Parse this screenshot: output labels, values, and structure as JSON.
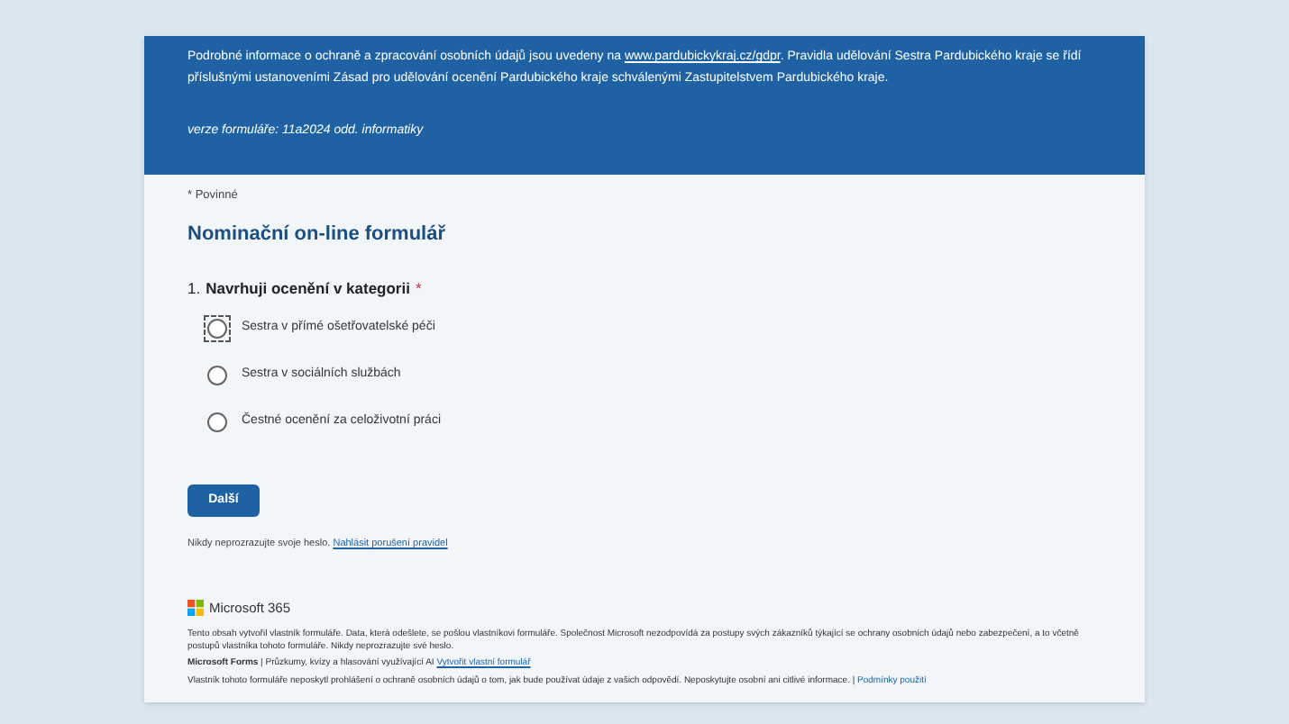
{
  "header": {
    "info_before": "Podrobné informace o ochraně a zpracování osobních údajů jsou uvedeny na ",
    "info_link": "www.pardubickykraj.cz/gdpr",
    "info_after": ". Pravidla udělování Sestra Pardubického kraje se řídí příslušnými ustanoveními Zásad pro udělování ocenění Pardubického kraje schválenými Zastupitelstvem Pardubického kraje.",
    "version": "verze formuláře: 11a2024 odd. informatiky"
  },
  "required_note": "* Povinné",
  "form_title": "Nominační on-line formulář",
  "question": {
    "number": "1.",
    "text": "Navrhuji ocenění v kategorii",
    "required_mark": "*",
    "options": [
      {
        "label": "Sestra v přímé ošetřovatelské péči",
        "selected": false,
        "focused": true
      },
      {
        "label": "Sestra v sociálních službách",
        "selected": false,
        "focused": false
      },
      {
        "label": "Čestné ocenění za celoživotní práci",
        "selected": false,
        "focused": false
      }
    ]
  },
  "next_button": "Další",
  "password_note": "Nikdy neprozrazujte svoje heslo.",
  "report_link": "Nahlásit porušení pravidel",
  "footer": {
    "brand": "Microsoft 365",
    "disclaimer": "Tento obsah vytvořil vlastník formuláře. Data, která odešlete, se pošlou vlastníkovi formuláře. Společnost Microsoft nezodpovídá za postupy svých zákazníků týkající se ochrany osobních údajů nebo zabezpečení, a to včetně postupů vlastníka tohoto formuláře. Nikdy neprozrazujte své heslo.",
    "forms_name": "Microsoft Forms",
    "forms_tagline": " | Průzkumy, kvízy a hlasování využívající AI ",
    "create_link": "Vytvořit vlastní formulář",
    "privacy": "Vlastník tohoto formuláře neposkytl prohlášení o ochraně osobních údajů o tom, jak bude používat údaje z vašich odpovědí. Neposkytujte osobní ani citlivé informace. | ",
    "terms_link": "Podmínky použití"
  }
}
